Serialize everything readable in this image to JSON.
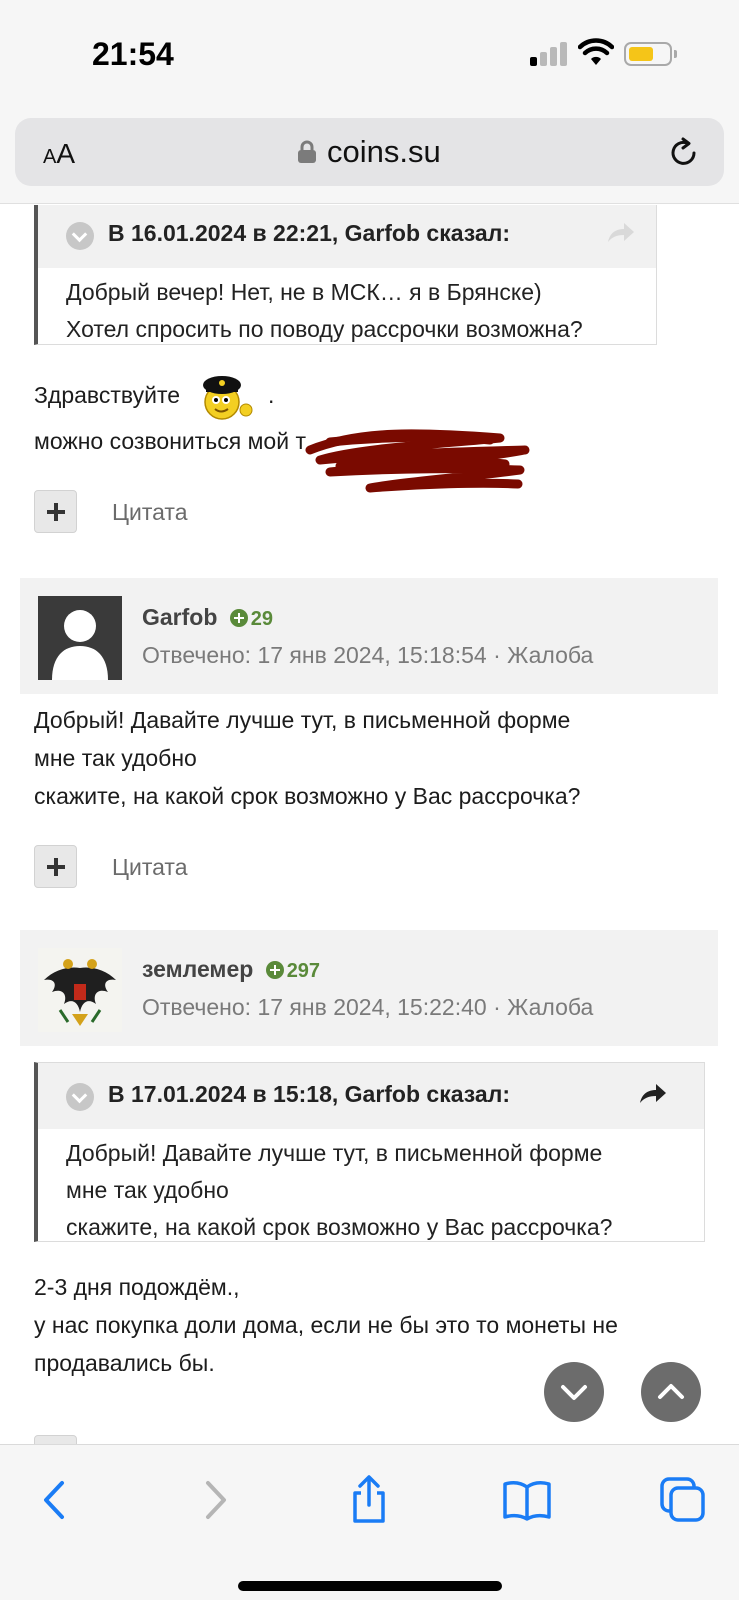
{
  "status": {
    "time": "21:54"
  },
  "browser": {
    "aa_label_small": "A",
    "aa_label_large": "A",
    "url": "coins.su"
  },
  "post1": {
    "quote": {
      "title": "В 16.01.2024 в 22:21, Garfob сказал:",
      "lines": [
        "Добрый вечер! Нет, не в МСК… я в Брянске)",
        "Хотел спросить по поводу рассрочки возможна?"
      ]
    },
    "greeting": "Здравствуйте",
    "greeting_suffix": ".",
    "line2": "можно созвониться мой т",
    "cite_label": "Цитата"
  },
  "post2": {
    "author": "Garfob",
    "reputation": "29",
    "meta": "Отвечено: 17 янв 2024, 15:18:54 · Жалоба",
    "lines": [
      "Добрый! Давайте лучше тут, в письменной форме",
      "мне так удобно",
      "скажите, на какой срок возможно у Вас рассрочка?"
    ],
    "cite_label": "Цитата"
  },
  "post3": {
    "author": "землемер",
    "reputation": "297",
    "meta": "Отвечено: 17 янв 2024, 15:22:40 · Жалоба",
    "quote": {
      "title": "В 17.01.2024 в 15:18, Garfob сказал:",
      "lines": [
        "Добрый! Давайте лучше тут, в письменной форме",
        "мне так удобно",
        "скажите, на какой срок возможно у Вас рассрочка?"
      ]
    },
    "lines": [
      "2-3 дня подождём.,",
      "у нас покупка доли дома, если не бы это то монеты не",
      "продавались бы."
    ]
  },
  "colors": {
    "accent": "#1a7cf5",
    "reputation": "#5a8a3a",
    "battery": "#f5c518",
    "scribble": "#7a0a00"
  },
  "icons": {
    "toolbar": [
      "back-icon",
      "forward-icon",
      "share-icon",
      "bookmarks-icon",
      "tabs-icon"
    ],
    "fabs": [
      "scroll-down-icon",
      "scroll-up-icon"
    ]
  }
}
